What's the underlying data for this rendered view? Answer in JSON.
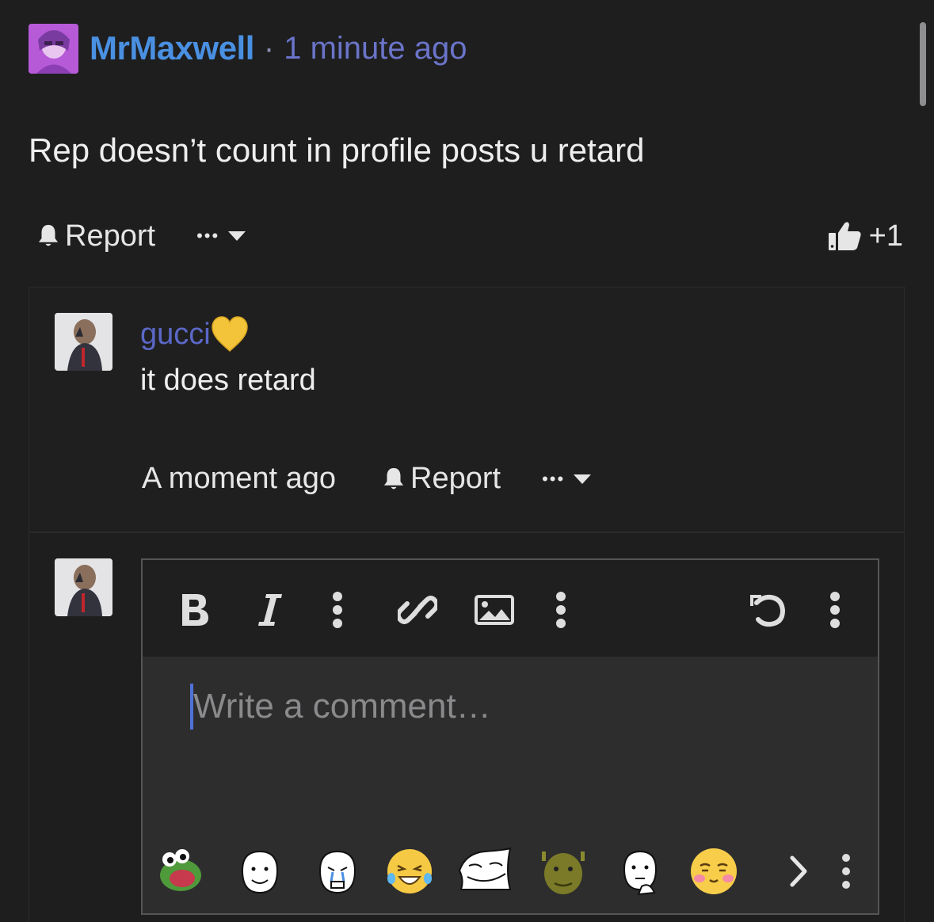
{
  "post": {
    "author": "MrMaxwell",
    "separator": "·",
    "timestamp": "1 minute ago",
    "body": "Rep doesn’t count in profile posts u retard",
    "actions": {
      "report_label": "Report",
      "more_label": "•••",
      "like_count": "+1"
    }
  },
  "reply": {
    "author": "gucci",
    "author_badge": "💛",
    "body": "it does retard",
    "timestamp": "A moment ago",
    "report_label": "Report",
    "more_label": "•••"
  },
  "composer": {
    "placeholder": "Write a comment…",
    "toolbar": [
      "bold-icon",
      "italic-icon",
      "more-vertical-icon",
      "link-icon",
      "image-icon",
      "more-vertical-icon",
      "undo-icon",
      "more-vertical-icon"
    ],
    "emoji_bar": [
      "pepe-frog-emoji",
      "wojak-smile-emoji",
      "wojak-crying-emoji",
      "laughing-tears-emoji",
      "trollface-emoji",
      "shrek-emoji",
      "wojak-thinking-emoji",
      "blushing-emoji",
      "next-arrow-icon",
      "more-vertical-icon"
    ]
  },
  "colors": {
    "background": "#1e1e1f",
    "author_link": "#4a90e2",
    "timestamp": "#6a74c8",
    "reply_author": "#5b68c7",
    "caret": "#4f72d6"
  }
}
